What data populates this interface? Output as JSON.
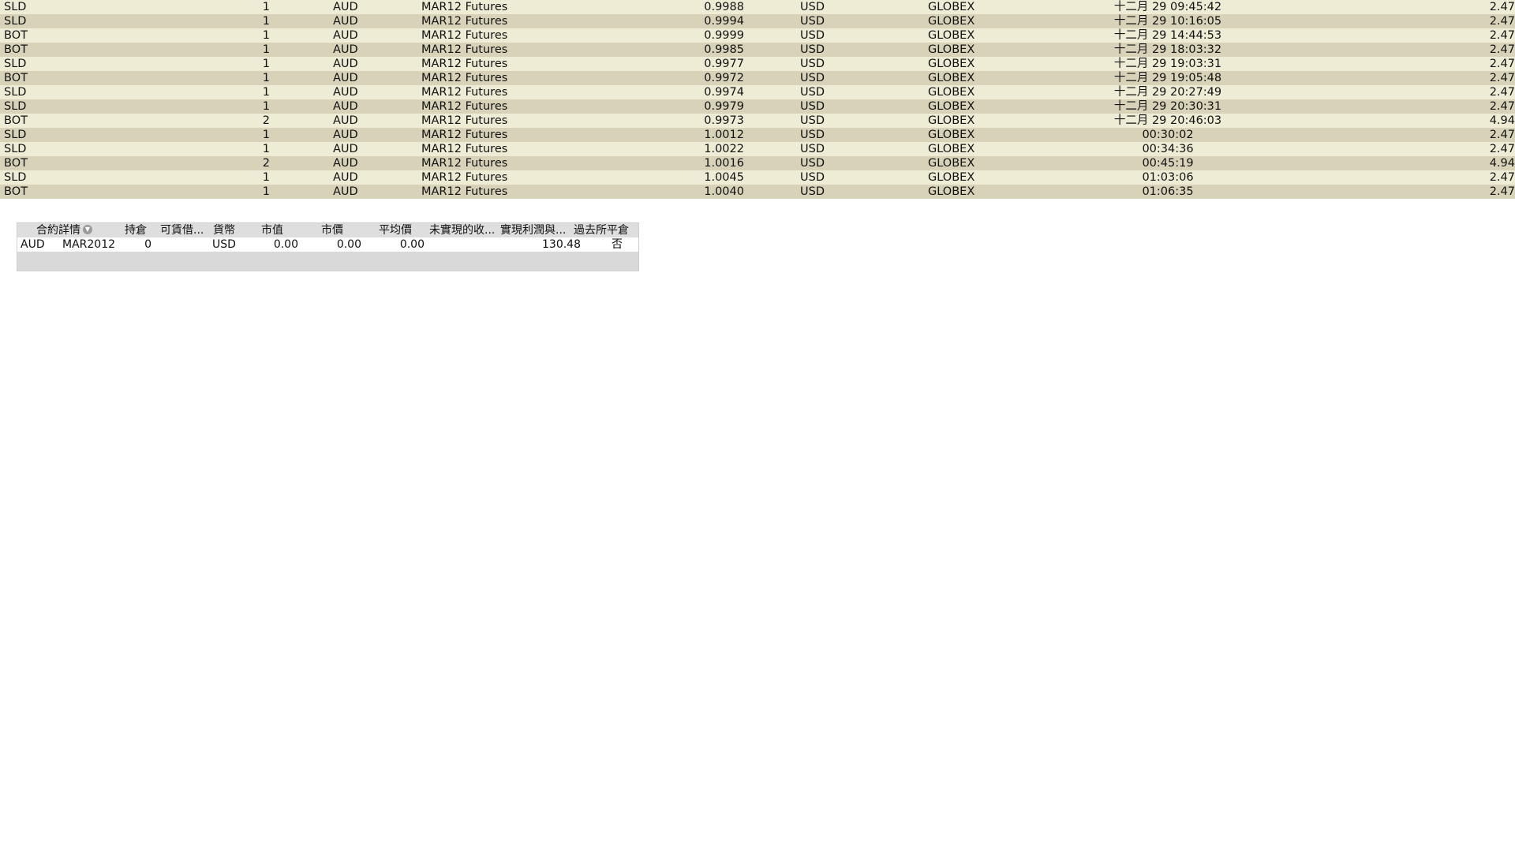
{
  "trades": [
    {
      "action": "SLD",
      "qty": "1",
      "symbol": "AUD",
      "description": "MAR12 Futures",
      "price": "0.9988",
      "currency": "USD",
      "exchange": "GLOBEX",
      "time": "十二月 29 09:45:42",
      "commission": "2.47"
    },
    {
      "action": "SLD",
      "qty": "1",
      "symbol": "AUD",
      "description": "MAR12 Futures",
      "price": "0.9994",
      "currency": "USD",
      "exchange": "GLOBEX",
      "time": "十二月 29 10:16:05",
      "commission": "2.47"
    },
    {
      "action": "BOT",
      "qty": "1",
      "symbol": "AUD",
      "description": "MAR12 Futures",
      "price": "0.9999",
      "currency": "USD",
      "exchange": "GLOBEX",
      "time": "十二月 29 14:44:53",
      "commission": "2.47"
    },
    {
      "action": "BOT",
      "qty": "1",
      "symbol": "AUD",
      "description": "MAR12 Futures",
      "price": "0.9985",
      "currency": "USD",
      "exchange": "GLOBEX",
      "time": "十二月 29 18:03:32",
      "commission": "2.47"
    },
    {
      "action": "SLD",
      "qty": "1",
      "symbol": "AUD",
      "description": "MAR12 Futures",
      "price": "0.9977",
      "currency": "USD",
      "exchange": "GLOBEX",
      "time": "十二月 29 19:03:31",
      "commission": "2.47"
    },
    {
      "action": "BOT",
      "qty": "1",
      "symbol": "AUD",
      "description": "MAR12 Futures",
      "price": "0.9972",
      "currency": "USD",
      "exchange": "GLOBEX",
      "time": "十二月 29 19:05:48",
      "commission": "2.47"
    },
    {
      "action": "SLD",
      "qty": "1",
      "symbol": "AUD",
      "description": "MAR12 Futures",
      "price": "0.9974",
      "currency": "USD",
      "exchange": "GLOBEX",
      "time": "十二月 29 20:27:49",
      "commission": "2.47"
    },
    {
      "action": "SLD",
      "qty": "1",
      "symbol": "AUD",
      "description": "MAR12 Futures",
      "price": "0.9979",
      "currency": "USD",
      "exchange": "GLOBEX",
      "time": "十二月 29 20:30:31",
      "commission": "2.47"
    },
    {
      "action": "BOT",
      "qty": "2",
      "symbol": "AUD",
      "description": "MAR12 Futures",
      "price": "0.9973",
      "currency": "USD",
      "exchange": "GLOBEX",
      "time": "十二月 29 20:46:03",
      "commission": "4.94"
    },
    {
      "action": "SLD",
      "qty": "1",
      "symbol": "AUD",
      "description": "MAR12 Futures",
      "price": "1.0012",
      "currency": "USD",
      "exchange": "GLOBEX",
      "time": "00:30:02",
      "commission": "2.47"
    },
    {
      "action": "SLD",
      "qty": "1",
      "symbol": "AUD",
      "description": "MAR12 Futures",
      "price": "1.0022",
      "currency": "USD",
      "exchange": "GLOBEX",
      "time": "00:34:36",
      "commission": "2.47"
    },
    {
      "action": "BOT",
      "qty": "2",
      "symbol": "AUD",
      "description": "MAR12 Futures",
      "price": "1.0016",
      "currency": "USD",
      "exchange": "GLOBEX",
      "time": "00:45:19",
      "commission": "4.94"
    },
    {
      "action": "SLD",
      "qty": "1",
      "symbol": "AUD",
      "description": "MAR12 Futures",
      "price": "1.0045",
      "currency": "USD",
      "exchange": "GLOBEX",
      "time": "01:03:06",
      "commission": "2.47"
    },
    {
      "action": "BOT",
      "qty": "1",
      "symbol": "AUD",
      "description": "MAR12 Futures",
      "price": "1.0040",
      "currency": "USD",
      "exchange": "GLOBEX",
      "time": "01:06:35",
      "commission": "2.47"
    }
  ],
  "portfolio": {
    "headers": {
      "contract_detail": "合約詳情",
      "sort_icon": "chevron-down-circle-icon",
      "position": "持倉",
      "shortable": "可賃借...",
      "currency": "貨幣",
      "market_value": "市值",
      "market_price": "市價",
      "avg_price": "平均價",
      "unrealized_pnl": "未實現的收...",
      "realized_pnl": "實現利潤與...",
      "closed": "過去所平倉"
    },
    "row": {
      "symbol": "AUD",
      "expiry": "MAR2012",
      "position": "0",
      "currency": "USD",
      "market_value": "0.00",
      "market_price": "0.00",
      "avg_price": "0.00",
      "realized_pnl": "130.48",
      "closed": "否"
    }
  },
  "colors": {
    "row_light": "#efecd6",
    "row_dark": "#d8d3b8",
    "panel_bg": "#d9d9d9"
  }
}
